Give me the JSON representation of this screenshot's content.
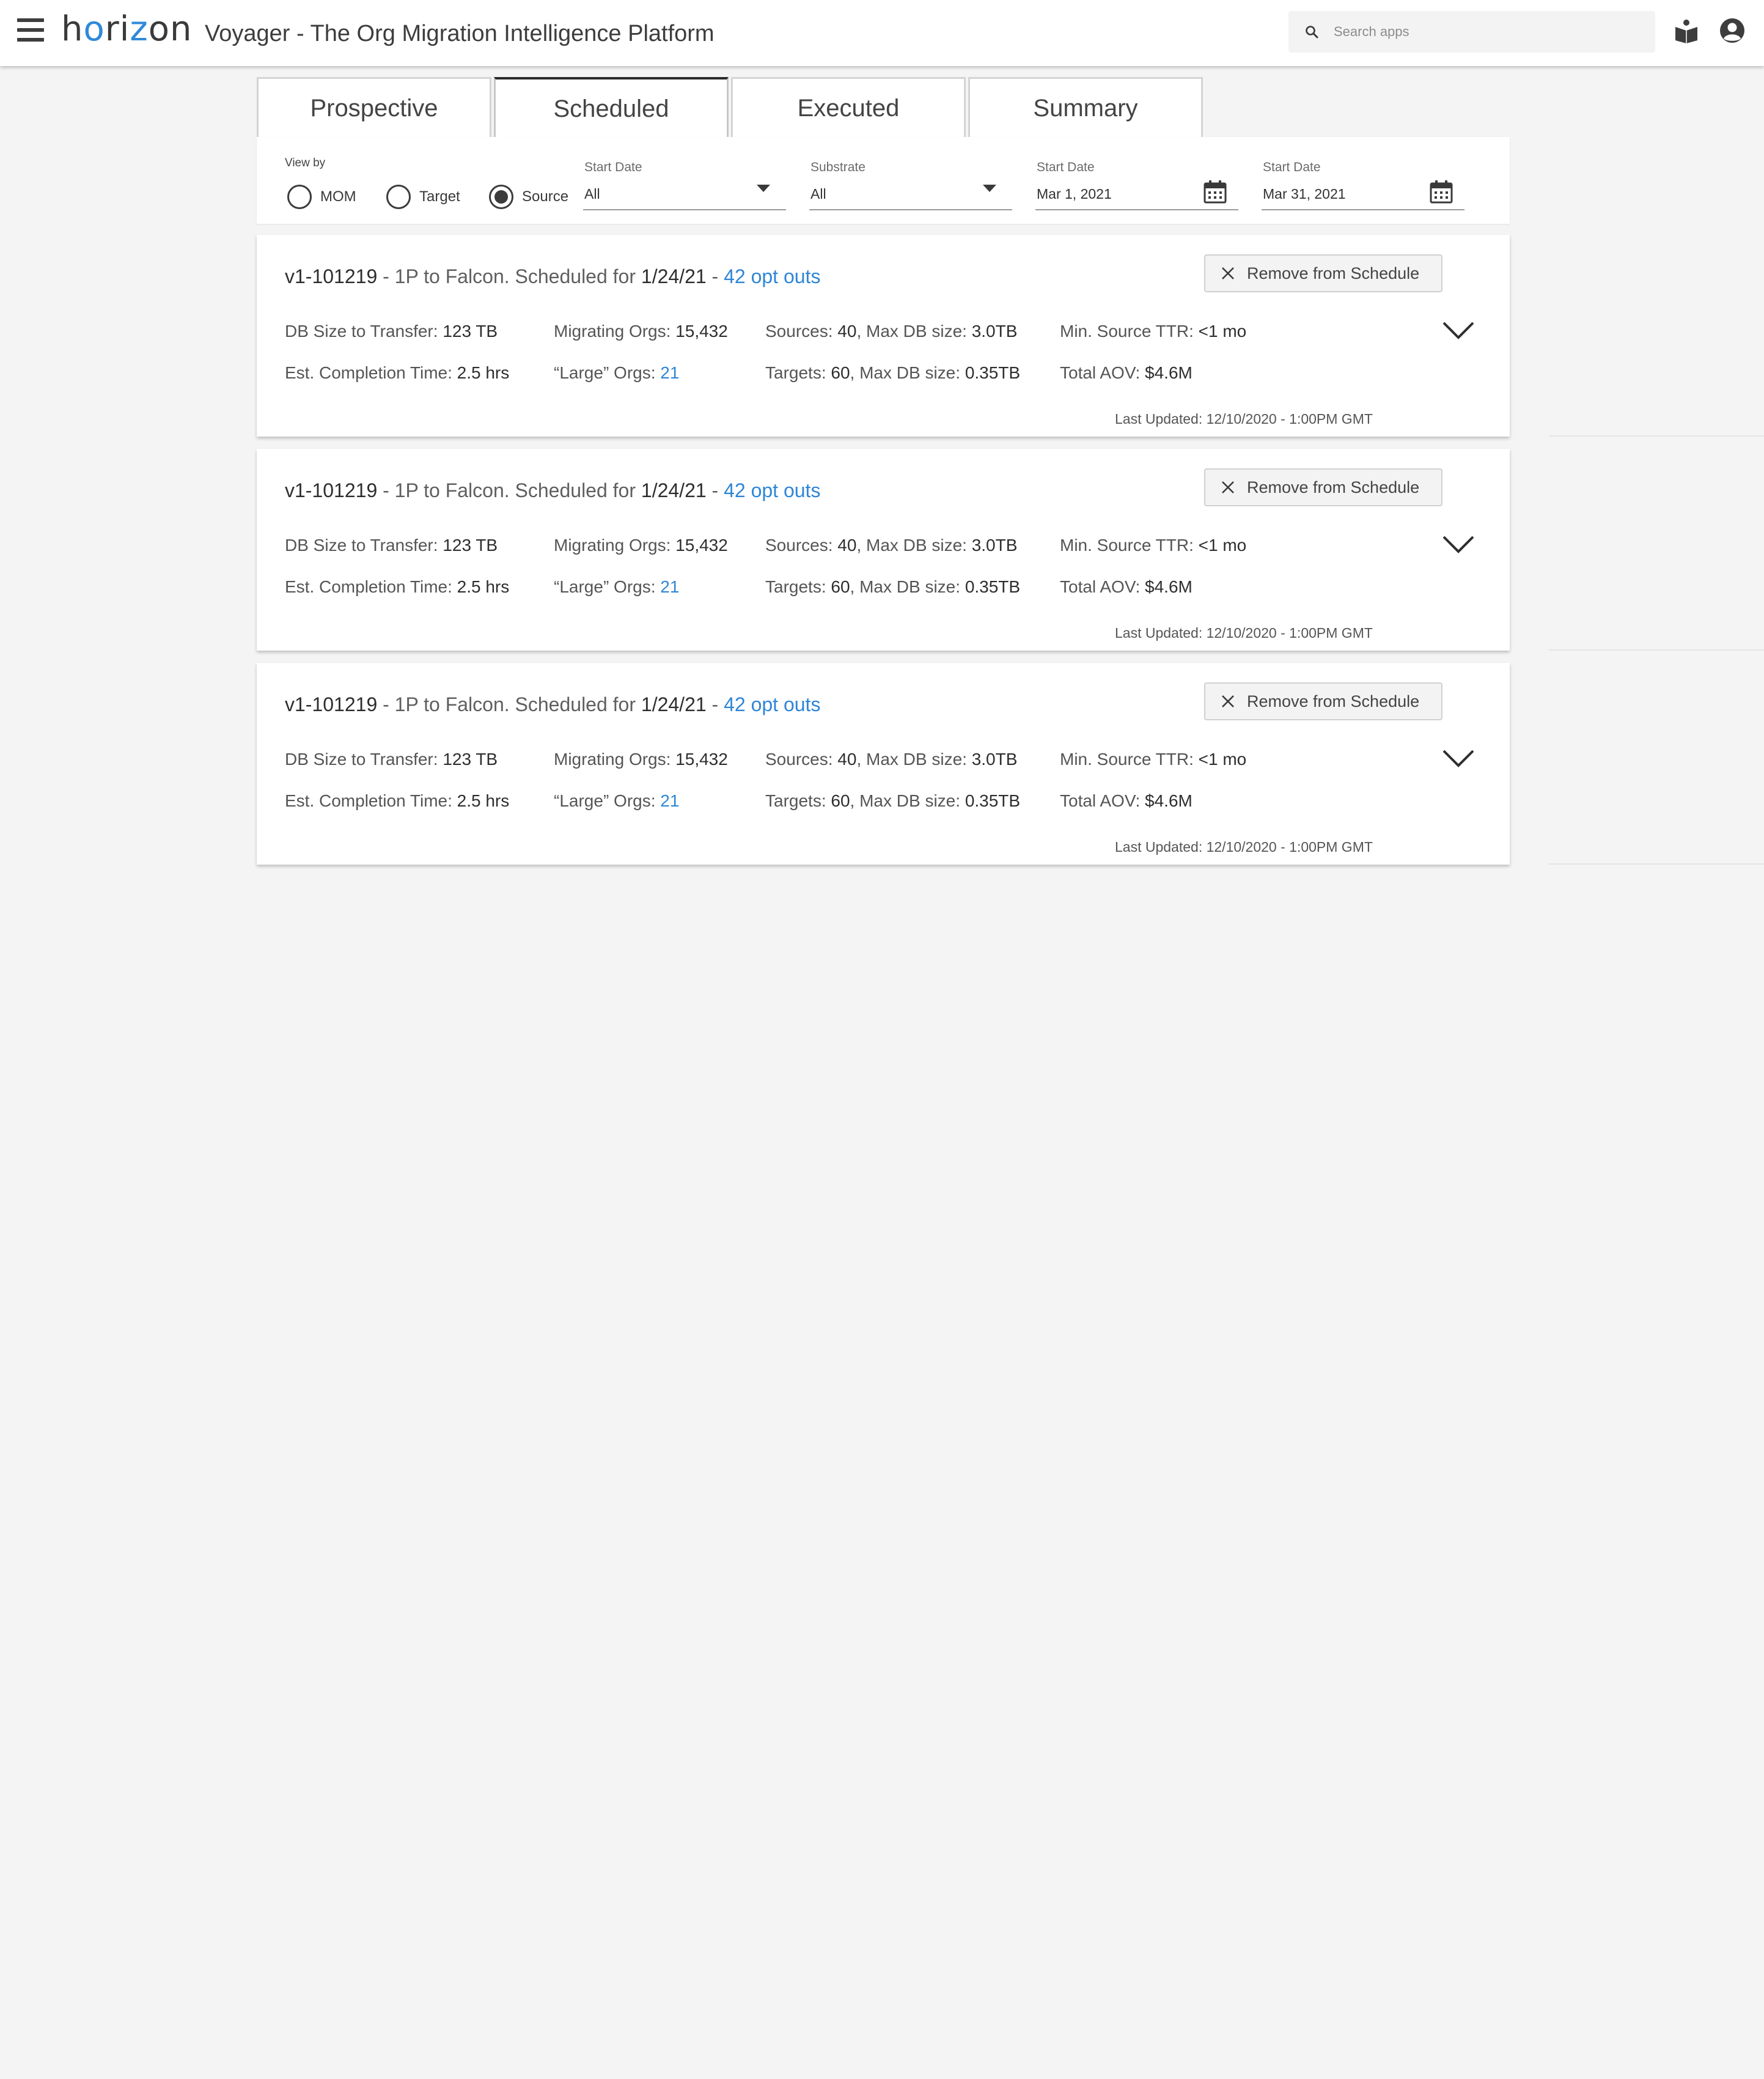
{
  "header": {
    "logo_text": "horizon",
    "app_title": "Voyager - The Org Migration Intelligence Platform",
    "search_placeholder": "Search apps",
    "icons": [
      "menu-icon",
      "search-icon",
      "book-icon",
      "user-icon"
    ]
  },
  "tabs": [
    {
      "label": "Prospective",
      "active": false
    },
    {
      "label": "Scheduled",
      "active": true
    },
    {
      "label": "Executed",
      "active": false
    },
    {
      "label": "Summary",
      "active": false
    }
  ],
  "filters": {
    "view_by_label": "View by",
    "radios": [
      {
        "label": "MOM",
        "selected": false
      },
      {
        "label": "Target",
        "selected": false
      },
      {
        "label": "Source",
        "selected": true
      }
    ],
    "dropdown_1": {
      "label": "Start Date",
      "value": "All"
    },
    "dropdown_2": {
      "label": "Substrate",
      "value": "All"
    },
    "date_1": {
      "label": "Start Date",
      "value": "Mar 1, 2021"
    },
    "date_2": {
      "label": "Start Date",
      "value": "Mar 31, 2021"
    }
  },
  "cards": [
    {
      "id": "v1-101219",
      "title_mid": " - 1P to Falcon. Scheduled for ",
      "date": "1/24/21",
      "sep": " - ",
      "opt_outs": "42 opt outs",
      "remove_label": "Remove from Schedule",
      "db_size_label": "DB Size to Transfer: ",
      "db_size": "123 TB",
      "completion_label": "Est. Completion Time: ",
      "completion": "2.5 hrs",
      "migrating_label": "Migrating Orgs: ",
      "migrating": "15,432",
      "large_label": "“Large” Orgs: ",
      "large": "21",
      "sources_label": "Sources: ",
      "sources": "40",
      "sources_db_label": ", Max DB size: ",
      "sources_db": "3.0TB",
      "targets_label": "Targets: ",
      "targets": "60",
      "targets_db_label": ", Max DB size: ",
      "targets_db": "0.35TB",
      "ttr_label": "Min. Source TTR: ",
      "ttr": "<1 mo",
      "aov_label": "Total AOV: ",
      "aov": "$4.6M",
      "last_updated": "Last Updated: 12/10/2020 - 1:00PM  GMT"
    },
    {
      "id": "v1-101219",
      "title_mid": " - 1P to Falcon. Scheduled for ",
      "date": "1/24/21",
      "sep": " - ",
      "opt_outs": "42 opt outs",
      "remove_label": "Remove from Schedule",
      "db_size_label": "DB Size to Transfer: ",
      "db_size": "123 TB",
      "completion_label": "Est. Completion Time: ",
      "completion": "2.5 hrs",
      "migrating_label": "Migrating Orgs: ",
      "migrating": "15,432",
      "large_label": "“Large” Orgs: ",
      "large": "21",
      "sources_label": "Sources: ",
      "sources": "40",
      "sources_db_label": ", Max DB size: ",
      "sources_db": "3.0TB",
      "targets_label": "Targets: ",
      "targets": "60",
      "targets_db_label": ", Max DB size: ",
      "targets_db": "0.35TB",
      "ttr_label": "Min. Source TTR: ",
      "ttr": "<1 mo",
      "aov_label": "Total AOV: ",
      "aov": "$4.6M",
      "last_updated": "Last Updated: 12/10/2020 - 1:00PM  GMT"
    },
    {
      "id": "v1-101219",
      "title_mid": " - 1P to Falcon. Scheduled for ",
      "date": "1/24/21",
      "sep": " - ",
      "opt_outs": "42 opt outs",
      "remove_label": "Remove from Schedule",
      "db_size_label": "DB Size to Transfer: ",
      "db_size": "123 TB",
      "completion_label": "Est. Completion Time: ",
      "completion": "2.5 hrs",
      "migrating_label": "Migrating Orgs: ",
      "migrating": "15,432",
      "large_label": "“Large” Orgs: ",
      "large": "21",
      "sources_label": "Sources: ",
      "sources": "40",
      "sources_db_label": ", Max DB size: ",
      "sources_db": "3.0TB",
      "targets_label": "Targets: ",
      "targets": "60",
      "targets_db_label": ", Max DB size: ",
      "targets_db": "0.35TB",
      "ttr_label": "Min. Source TTR: ",
      "ttr": "<1 mo",
      "aov_label": "Total AOV: ",
      "aov": "$4.6M",
      "last_updated": "Last Updated: 12/10/2020 - 1:00PM  GMT"
    }
  ],
  "colors": {
    "accent": "#2f86d6",
    "text": "#3c3c3c",
    "background": "#f4f4f4"
  }
}
